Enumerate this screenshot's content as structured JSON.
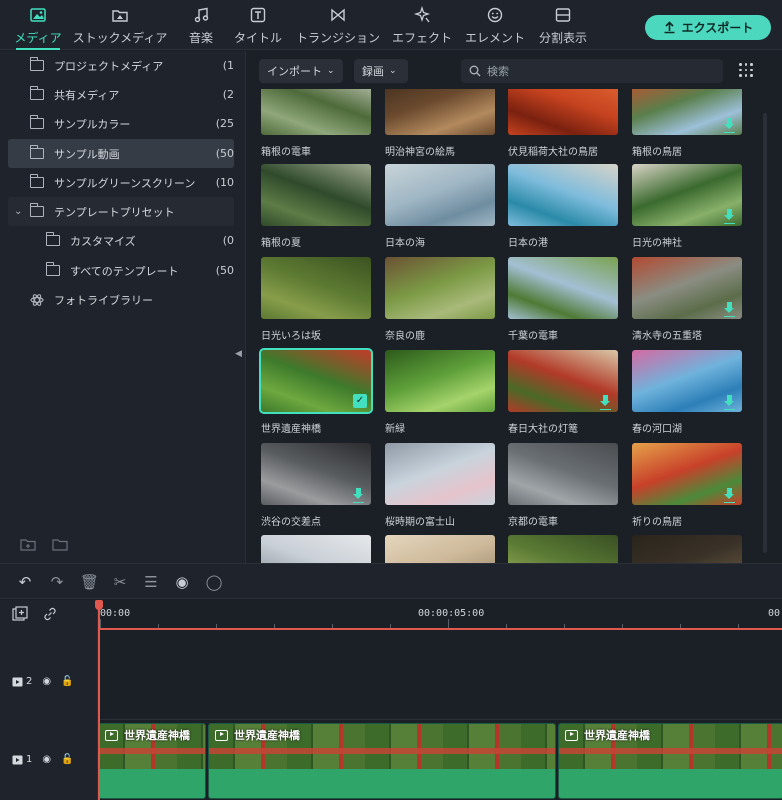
{
  "toolbar": {
    "tabs": [
      {
        "label": "メディア",
        "icon": "media-icon",
        "active": true
      },
      {
        "label": "ストックメディア",
        "icon": "stock-media-icon"
      },
      {
        "label": "音楽",
        "icon": "music-icon"
      },
      {
        "label": "タイトル",
        "icon": "title-icon"
      },
      {
        "label": "トランジション",
        "icon": "transition-icon"
      },
      {
        "label": "エフェクト",
        "icon": "effect-icon"
      },
      {
        "label": "エレメント",
        "icon": "element-icon"
      },
      {
        "label": "分割表示",
        "icon": "split-screen-icon"
      }
    ],
    "export_label": "エクスポート"
  },
  "sidebar": {
    "items": [
      {
        "label": "プロジェクトメディア",
        "count": "(1"
      },
      {
        "label": "共有メディア",
        "count": "(2"
      },
      {
        "label": "サンプルカラー",
        "count": "(25"
      },
      {
        "label": "サンプル動画",
        "count": "(50",
        "selected": true
      },
      {
        "label": "サンプルグリーンスクリーン",
        "count": "(10"
      },
      {
        "label": "テンプレートプリセット",
        "count": "",
        "expanded": true
      },
      {
        "label": "カスタマイズ",
        "count": "(0"
      },
      {
        "label": "すべてのテンプレート",
        "count": "(50"
      },
      {
        "label": "フォトライブラリー",
        "count": ""
      }
    ]
  },
  "media": {
    "import_label": "インポート",
    "record_label": "録画",
    "search_placeholder": "検索",
    "items": [
      {
        "name": "箱根の電車",
        "colors": [
          "#4e6a3a",
          "#8fa77a",
          "#cfd2c4"
        ],
        "download": false
      },
      {
        "name": "明治神宮の絵馬",
        "colors": [
          "#6b4a2e",
          "#b38a5e",
          "#3b2a1c"
        ],
        "download": false
      },
      {
        "name": "伏見稲荷大社の鳥居",
        "colors": [
          "#c6431f",
          "#7a2110",
          "#e56b36"
        ],
        "download": false
      },
      {
        "name": "箱根の鳥居",
        "colors": [
          "#5a7f4c",
          "#9cc0d8",
          "#d14a2a"
        ],
        "download": true
      },
      {
        "name": "箱根の夏",
        "colors": [
          "#2f4a2b",
          "#5d7c46",
          "#9fa88f"
        ],
        "download": false
      },
      {
        "name": "日本の海",
        "colors": [
          "#9fb6c4",
          "#6f8da0",
          "#c8d4d8"
        ],
        "download": false
      },
      {
        "name": "日本の港",
        "colors": [
          "#7fbcdc",
          "#2a8aa8",
          "#d6d3c8"
        ],
        "download": false
      },
      {
        "name": "日光の神社",
        "colors": [
          "#3b6a2f",
          "#88b06a",
          "#d9d4c6"
        ],
        "download": true
      },
      {
        "name": "日光いろは坂",
        "colors": [
          "#5d7a32",
          "#879d4a",
          "#3b5221"
        ],
        "download": false
      },
      {
        "name": "奈良の鹿",
        "colors": [
          "#7b9a45",
          "#a9b97a",
          "#6b5234"
        ],
        "download": false
      },
      {
        "name": "千葉の電車",
        "colors": [
          "#a3bfd4",
          "#4f7a35",
          "#7aa24f"
        ],
        "download": false
      },
      {
        "name": "清水寺の五重塔",
        "colors": [
          "#8a8d82",
          "#5c6d4a",
          "#b34a32"
        ],
        "download": true
      },
      {
        "name": "世界遺産神橋",
        "colors": [
          "#3d7a2b",
          "#6ea83f",
          "#c23b2a"
        ],
        "download": false,
        "selected": true
      },
      {
        "name": "新緑",
        "colors": [
          "#5fa03a",
          "#a6d36b",
          "#2c5a1b"
        ],
        "download": false
      },
      {
        "name": "春日大社の灯篭",
        "colors": [
          "#b23a28",
          "#4a6a28",
          "#d9c8a8"
        ],
        "download": true
      },
      {
        "name": "春の河口湖",
        "colors": [
          "#6fb3dc",
          "#2d7fb8",
          "#d56aa2"
        ],
        "download": true
      },
      {
        "name": "渋谷の交差点",
        "colors": [
          "#5a5d60",
          "#9a9c9e",
          "#2a2c2e"
        ],
        "download": true
      },
      {
        "name": "桜時期の富士山",
        "colors": [
          "#c9d3dc",
          "#e6c4cc",
          "#8f9aa6"
        ],
        "download": false
      },
      {
        "name": "京都の電車",
        "colors": [
          "#6a6f74",
          "#a0a5a8",
          "#4a4d50"
        ],
        "download": false
      },
      {
        "name": "祈りの鳥居",
        "colors": [
          "#c8412a",
          "#4b8a3a",
          "#e6a24a"
        ],
        "download": true
      },
      {
        "name": "",
        "colors": [
          "#c9cfd6",
          "#9aa3ad",
          "#e6e8ea"
        ],
        "download": false
      },
      {
        "name": "",
        "colors": [
          "#cdb89a",
          "#a89578",
          "#e4d6bc"
        ],
        "download": false
      },
      {
        "name": "",
        "colors": [
          "#5a7a34",
          "#8aa150",
          "#3a5024"
        ],
        "download": false
      },
      {
        "name": "",
        "colors": [
          "#3a3228",
          "#5e4e3a",
          "#2a241c"
        ],
        "download": false
      }
    ]
  },
  "timeline": {
    "timecode_start": "00:00",
    "timecode_mid": "00:00:05:00",
    "timecode_end": "00",
    "tracks": [
      {
        "label": "2"
      },
      {
        "label": "1"
      }
    ],
    "clips": [
      {
        "title": "世界遺産神橋"
      },
      {
        "title": "世界遺産神橋"
      },
      {
        "title": "世界遺産神橋"
      }
    ]
  }
}
